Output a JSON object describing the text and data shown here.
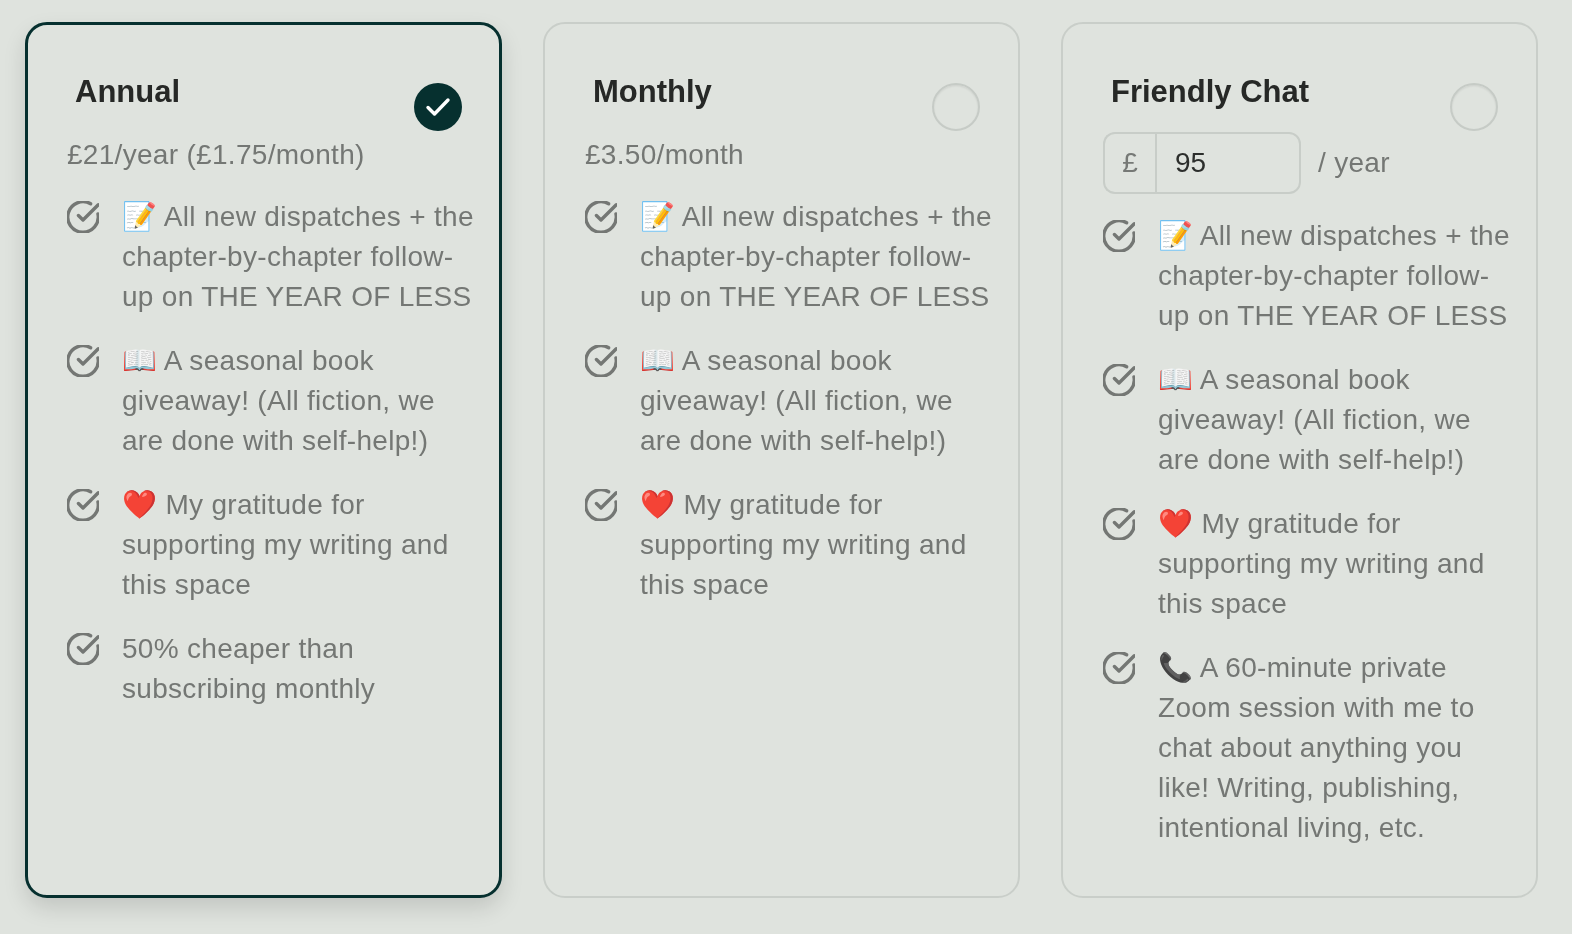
{
  "plans": [
    {
      "name": "Annual",
      "selected": true,
      "kind": "fixed",
      "price": "£21/year (£1.75/month)",
      "features": [
        {
          "text": "📝 All new dispatches + the chapter-by-chapter follow-up on THE YEAR OF LESS"
        },
        {
          "text": "📖 A seasonal book giveaway! (All fiction, we are done with self-help!)"
        },
        {
          "text": "❤️ My gratitude for supporting my writing and this space"
        },
        {
          "text": "50% cheaper than subscribing monthly"
        }
      ]
    },
    {
      "name": "Monthly",
      "selected": false,
      "kind": "fixed",
      "price": "£3.50/month",
      "features": [
        {
          "text": "📝 All new dispatches + the chapter-by-chapter follow-up on THE YEAR OF LESS"
        },
        {
          "text": "📖 A seasonal book giveaway! (All fiction, we are done with self-help!)"
        },
        {
          "text": "❤️ My gratitude for supporting my writing and this space"
        }
      ]
    },
    {
      "name": "Friendly Chat",
      "selected": false,
      "kind": "custom",
      "amount": {
        "prefix": "£",
        "value": "95",
        "suffix": "/ year"
      },
      "features": [
        {
          "text": "📝 All new dispatches + the chapter-by-chapter follow-up on THE YEAR OF LESS"
        },
        {
          "text": "📖 A seasonal book giveaway! (All fiction, we are done with self-help!)"
        },
        {
          "text": "❤️ My gratitude for supporting my writing and this space"
        },
        {
          "text": "📞 A 60-minute private Zoom session with me to chat about anything you like! Writing, publishing, intentional living, etc."
        }
      ]
    }
  ]
}
